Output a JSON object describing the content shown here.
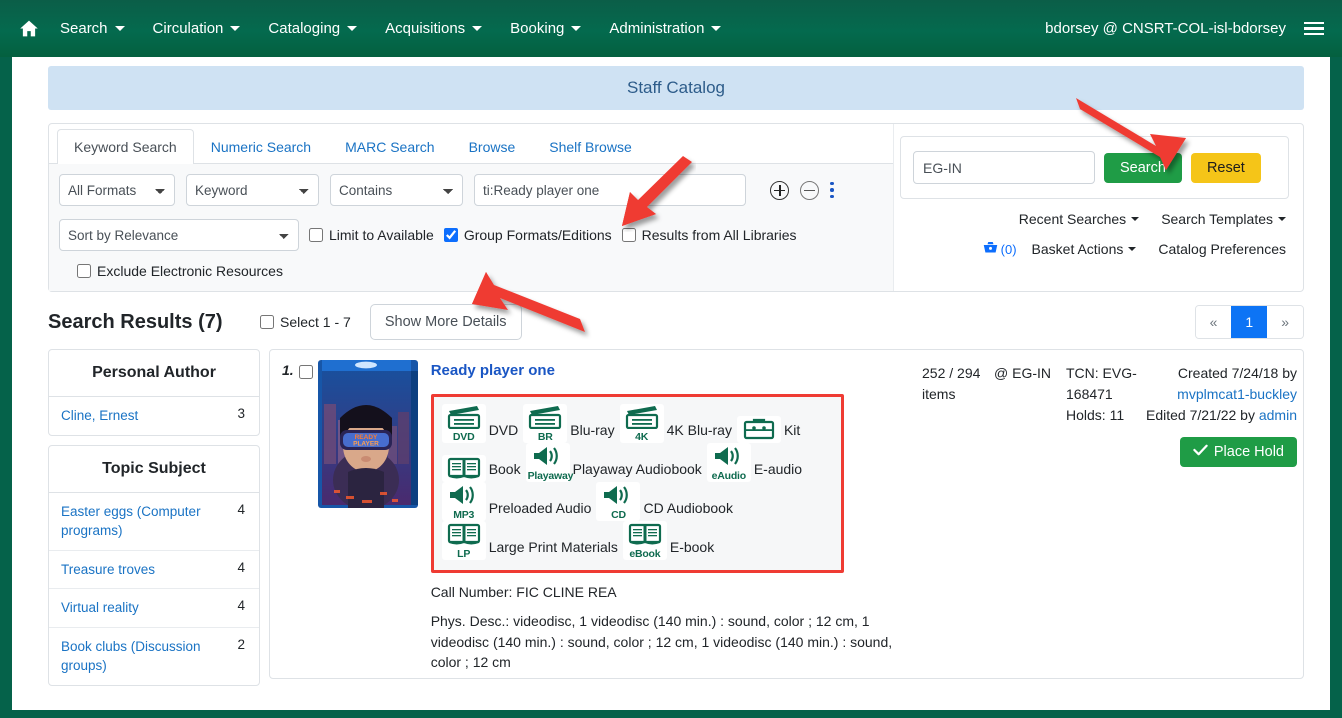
{
  "navbar": {
    "home_icon": "home-icon",
    "menus": [
      {
        "label": "Search"
      },
      {
        "label": "Circulation"
      },
      {
        "label": "Cataloging"
      },
      {
        "label": "Acquisitions"
      },
      {
        "label": "Booking"
      },
      {
        "label": "Administration"
      }
    ],
    "user": "bdorsey @ CNSRT-COL-isl-bdorsey",
    "menu_icon": "hamburger-menu-icon",
    "bg_color": "#046a4e"
  },
  "banner": {
    "title": "Staff Catalog",
    "bg_color": "#cfe2f3",
    "text_color": "#2d5c8a"
  },
  "search": {
    "tabs": [
      {
        "label": "Keyword Search",
        "active": true
      },
      {
        "label": "Numeric Search",
        "active": false
      },
      {
        "label": "MARC Search",
        "active": false
      },
      {
        "label": "Browse",
        "active": false
      },
      {
        "label": "Shelf Browse",
        "active": false
      }
    ],
    "format_select": "All Formats",
    "field_select": "Keyword",
    "operator_select": "Contains",
    "term_value": "ti:Ready player one",
    "term_placeholder": "",
    "add_row_icon": "plus-circle-icon",
    "remove_row_icon": "minus-circle-icon",
    "more_options_icon": "kebab-menu-icon",
    "sort_select": "Sort by Relevance",
    "checkboxes": [
      {
        "label": "Limit to Available",
        "checked": false
      },
      {
        "label": "Group Formats/Editions",
        "checked": true
      },
      {
        "label": "Results from All Libraries",
        "checked": false
      },
      {
        "label": "Exclude Electronic Resources",
        "checked": false
      }
    ],
    "library_value": "EG-IN",
    "search_button": "Search",
    "reset_button": "Reset",
    "search_button_color": "#1f9c46",
    "reset_button_color": "#f5c518",
    "links": [
      {
        "label": "Recent Searches",
        "caret": true
      },
      {
        "label": "Search Templates",
        "caret": true
      },
      {
        "label": "Basket Actions",
        "caret": true
      },
      {
        "label": "Catalog Preferences",
        "caret": false
      }
    ],
    "basket_icon": "basket-icon",
    "basket_count": "(0)"
  },
  "results": {
    "heading": "Search Results (7)",
    "select_all_label": "Select 1 - 7",
    "select_all_checked": false,
    "show_more_details": "Show More Details",
    "pager": {
      "prev": "«",
      "current": "1",
      "next": "»"
    }
  },
  "facets": [
    {
      "title": "Personal Author",
      "rows": [
        {
          "label": "Cline, Ernest",
          "count": "3"
        }
      ]
    },
    {
      "title": "Topic Subject",
      "rows": [
        {
          "label": "Easter eggs (Computer programs)",
          "count": "4"
        },
        {
          "label": "Treasure troves",
          "count": "4"
        },
        {
          "label": "Virtual reality",
          "count": "4"
        },
        {
          "label": "Book clubs (Discussion groups)",
          "count": "2"
        }
      ]
    }
  ],
  "record": {
    "number": "1.",
    "selected": false,
    "cover_alt": "Ready player one Blu-ray cover",
    "title": "Ready player one",
    "items_count": "252 / 294 items",
    "library": "@ EG-IN",
    "tcn": "TCN: EVG-168471",
    "holds": "Holds: 11",
    "created": "Created 7/24/18 by",
    "created_by": "mvplmcat1-buckley",
    "edited": "Edited 7/21/22 by",
    "edited_by": "admin",
    "place_hold": "Place Hold",
    "place_hold_icon": "check-icon",
    "call_number": "Call Number: FIC CLINE REA",
    "phys_desc": "Phys. Desc.: videodisc, 1 videodisc (140 min.) : sound, color ; 12 cm, 1 videodisc (140 min.) : sound, color ; 12 cm, 1 videodisc (140 min.) : sound, color ; 12 cm",
    "formats": [
      {
        "caption": "DVD",
        "label": "DVD",
        "icon": "videodisc-icon"
      },
      {
        "caption": "BR",
        "label": "Blu-ray",
        "icon": "videodisc-icon"
      },
      {
        "caption": "4K",
        "label": "4K Blu-ray",
        "icon": "videodisc-icon"
      },
      {
        "caption": "",
        "label": "Kit",
        "icon": "kit-icon"
      },
      {
        "caption": "",
        "label": "Book",
        "icon": "book-icon"
      },
      {
        "caption": "Playaway",
        "label": "Playaway Audiobook",
        "icon": "speaker-icon"
      },
      {
        "caption": "eAudio",
        "label": "E-audio",
        "icon": "speaker-icon"
      },
      {
        "caption": "MP3",
        "label": "Preloaded Audio",
        "icon": "speaker-icon"
      },
      {
        "caption": "CD",
        "label": "CD Audiobook",
        "icon": "speaker-icon"
      },
      {
        "caption": "LP",
        "label": "Large Print Materials",
        "icon": "book-icon"
      },
      {
        "caption": "eBook",
        "label": "E-book",
        "icon": "book-icon"
      }
    ],
    "highlight_color": "#ef3b33"
  },
  "annotations": {
    "arrow_color": "#ef3b33",
    "arrows": [
      "points-to-search-term-input",
      "points-to-search-button",
      "points-to-group-formats-checkbox"
    ]
  }
}
